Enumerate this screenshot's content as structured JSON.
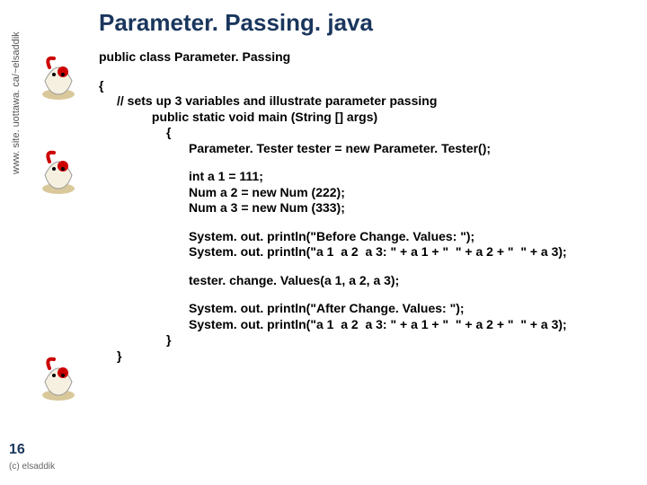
{
  "title": "Parameter. Passing. java",
  "sidebar_url": "www. site. uottawa. ca/~elsaddik",
  "page_number": "16",
  "copyright": "(c) elsaddik",
  "code": {
    "class_decl": "public class Parameter. Passing",
    "open_brace": "{",
    "comment": "// sets up 3 variables and illustrate parameter passing",
    "main_decl": " public static void main (String [] args)",
    "main_open": "{",
    "tester_line": "Parameter. Tester tester = new Parameter. Tester();",
    "a1": "int a 1 = 111;",
    "a2": "Num a 2 = new Num (222);",
    "a3": "Num a 3 = new Num (333);",
    "before1": "System. out. println(\"Before Change. Values: \");",
    "before2": "System. out. println(\"a 1  a 2  a 3: \" + a 1 + \"  \" + a 2 + \"  \" + a 3);",
    "change": "tester. change. Values(a 1, a 2, a 3);",
    "after1": "System. out. println(\"After Change. Values: \");",
    "after2": "System. out. println(\"a 1  a 2  a 3: \" + a 1 + \"  \" + a 2 + \"  \" + a 3);",
    "main_close": "}",
    "class_close": "}"
  }
}
